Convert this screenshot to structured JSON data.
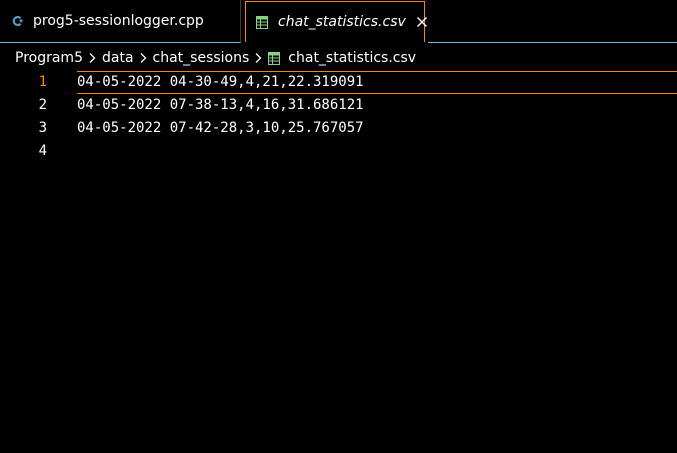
{
  "tabs": [
    {
      "label": "prog5-sessionlogger.cpp",
      "icon": "cpp-file-icon",
      "active": false
    },
    {
      "label": "chat_statistics.csv",
      "icon": "csv-file-icon",
      "active": true
    }
  ],
  "breadcrumb": {
    "items": [
      "Program5",
      "data",
      "chat_sessions",
      "chat_statistics.csv"
    ]
  },
  "editor": {
    "current_line": 1,
    "lines": [
      {
        "number": "1",
        "text": "04-05-2022 04-30-49,4,21,22.319091"
      },
      {
        "number": "2",
        "text": "04-05-2022 07-38-13,4,16,31.686121"
      },
      {
        "number": "3",
        "text": "04-05-2022 07-42-28,3,10,25.767057"
      },
      {
        "number": "4",
        "text": ""
      }
    ]
  },
  "colors": {
    "background": "#000000",
    "accent_orange": "#f38518",
    "accent_cyan": "#6fc3df",
    "csv_icon_green": "#89d185",
    "cpp_icon_blue": "#519aba",
    "text": "#ffffff"
  }
}
